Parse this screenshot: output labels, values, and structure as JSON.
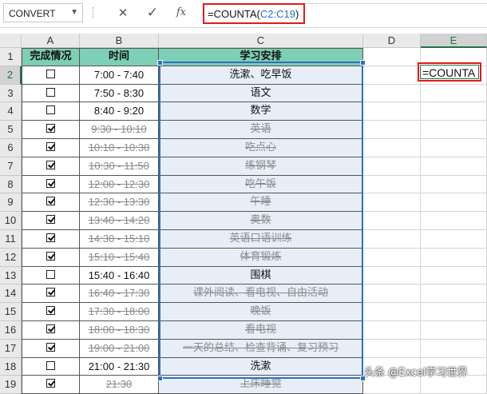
{
  "formula_bar": {
    "name_box": "CONVERT",
    "cancel_glyph": "✕",
    "enter_glyph": "✓",
    "fx_glyph": "fx",
    "formula_prefix": "=COUNTA(",
    "formula_ref": "C2:C19",
    "formula_suffix": ")"
  },
  "columns": [
    "A",
    "B",
    "C",
    "D",
    "E"
  ],
  "rows": [
    "1",
    "2",
    "3",
    "4",
    "5",
    "6",
    "7",
    "8",
    "9",
    "10",
    "11",
    "12",
    "13",
    "14",
    "15",
    "16",
    "17",
    "18",
    "19"
  ],
  "table": {
    "headers": {
      "status": "完成情况",
      "time": "时间",
      "plan": "学习安排"
    },
    "entries": [
      {
        "checked": false,
        "time": "7:00 - 7:40",
        "plan": "洗漱、吃早饭",
        "done": false
      },
      {
        "checked": false,
        "time": "7:50 - 8:30",
        "plan": "语文",
        "done": false
      },
      {
        "checked": false,
        "time": "8:40 - 9:20",
        "plan": "数学",
        "done": false
      },
      {
        "checked": true,
        "time": "9:30 - 10:10",
        "plan": "英语",
        "done": true
      },
      {
        "checked": true,
        "time": "10:10 - 10:30",
        "plan": "吃点心",
        "done": true
      },
      {
        "checked": true,
        "time": "10:30 - 11:50",
        "plan": "练钢琴",
        "done": true
      },
      {
        "checked": true,
        "time": "12:00 - 12:30",
        "plan": "吃午饭",
        "done": true
      },
      {
        "checked": true,
        "time": "12:30 - 13:30",
        "plan": "午睡",
        "done": true
      },
      {
        "checked": true,
        "time": "13:40 - 14:20",
        "plan": "奥数",
        "done": true
      },
      {
        "checked": true,
        "time": "14:30 - 15:10",
        "plan": "英语口语训练",
        "done": true
      },
      {
        "checked": true,
        "time": "15:10 - 15:40",
        "plan": "体育锻炼",
        "done": true
      },
      {
        "checked": false,
        "time": "15:40 - 16:40",
        "plan": "围棋",
        "done": false
      },
      {
        "checked": true,
        "time": "16:40 - 17:30",
        "plan": "课外阅读、看电视、自由活动",
        "done": true
      },
      {
        "checked": true,
        "time": "17:30 - 18:00",
        "plan": "晚饭",
        "done": true
      },
      {
        "checked": true,
        "time": "18:00 - 18:30",
        "plan": "看电视",
        "done": true
      },
      {
        "checked": true,
        "time": "19:00 - 21:00",
        "plan": "一天的总结、检查背诵、复习预习",
        "done": true
      },
      {
        "checked": false,
        "time": "21:00 - 21:30",
        "plan": "洗漱",
        "done": false
      },
      {
        "checked": true,
        "time": "21:30",
        "plan": "上床睡觉",
        "done": true
      }
    ]
  },
  "active_cell": {
    "ref": "E2",
    "content": "=COUNTA"
  },
  "watermark": "头条 @Excel学习世界",
  "colors": {
    "header_fill": "#7dcfb6",
    "selection_border": "#2e6fc0",
    "highlight_border": "#e01b1b",
    "done_text": "#8a8a8a",
    "excel_green": "#217346"
  }
}
